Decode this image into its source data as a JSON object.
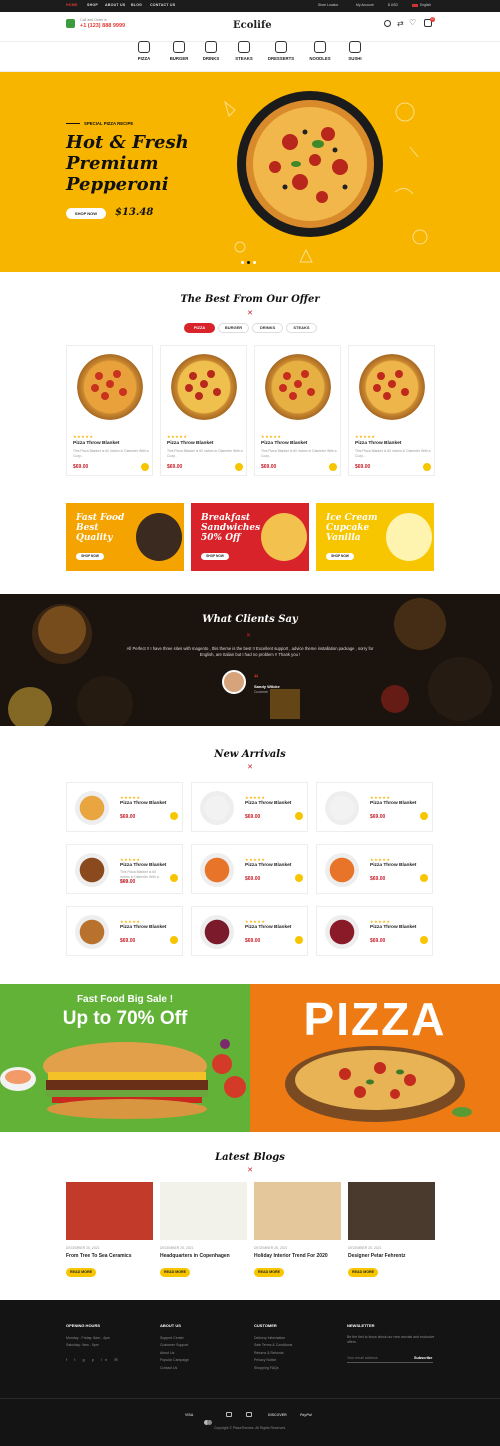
{
  "topnav": {
    "items": [
      "HOME",
      "SHOP",
      "ABOUT US",
      "BLOG",
      "CONTACT US"
    ],
    "store_locator": "Store Locator",
    "my_account": "My Account",
    "currency": "$ USD",
    "language": "English"
  },
  "header": {
    "call_label": "Call and Order in",
    "phone": "+1 (123) 888 9999",
    "logo": "Ecolife",
    "cart_count": "0"
  },
  "categories": [
    {
      "label": "PIZZA",
      "icon": "pizza-icon"
    },
    {
      "label": "BURGER",
      "icon": "burger-icon"
    },
    {
      "label": "DRINKS",
      "icon": "drink-icon"
    },
    {
      "label": "STEAKS",
      "icon": "steak-icon"
    },
    {
      "label": "DRESSERTS",
      "icon": "dessert-icon"
    },
    {
      "label": "NOODLES",
      "icon": "noodles-icon"
    },
    {
      "label": "SUSHI",
      "icon": "sushi-icon"
    }
  ],
  "hero": {
    "kicker": "SPECIAL PIZZA RECIPE",
    "title": "Hot & Fresh Premium Pepperoni",
    "button": "SHOP NOW",
    "price": "$13.48"
  },
  "offer": {
    "title": "The Best From Our Offer",
    "tabs": [
      "PIZZA",
      "BURGER",
      "DRINKS",
      "STEAKS"
    ],
    "products": [
      {
        "name": "Pizza Throw Blanket",
        "desc": "This Pizza Blanket is 60 inches in Diameter With a Cozy...",
        "price": "$69.00",
        "rating": "★★★★★"
      },
      {
        "name": "Pizza Throw Blanket",
        "desc": "This Pizza Blanket is 60 inches in Diameter With a Cozy...",
        "price": "$69.00",
        "rating": "★★★★★"
      },
      {
        "name": "Pizza Throw Blanket",
        "desc": "This Pizza Blanket is 60 inches in Diameter With a Cozy...",
        "price": "$69.00",
        "rating": "★★★★★"
      },
      {
        "name": "Pizza Throw Blanket",
        "desc": "This Pizza Blanket is 60 inches in Diameter With a Cozy...",
        "price": "$69.00",
        "rating": "★★★★★"
      }
    ]
  },
  "banners": [
    {
      "title": "Fast Food Best Quality",
      "button": "SHOP NOW",
      "color": "#f5a300"
    },
    {
      "title": "Breakfast Sandwiches 50% Off",
      "button": "SHOP NOW",
      "color": "#d8232a"
    },
    {
      "title": "Ice Cream Cupcake Vanilla",
      "button": "SHOP NOW",
      "color": "#f7c600"
    }
  ],
  "testimonial": {
    "title": "What Clients Say",
    "quote": "All Perfect !! I have three sites with magento , this theme is the best !! Excellent support , advice theme installation package , sorry for English, are Italian but I had no problem !! Thank you !",
    "name": "Sandy Wilcke",
    "role": "Customer"
  },
  "arrivals": {
    "title": "New Arrivals",
    "items": [
      {
        "name": "Pizza Throw Blanket",
        "price": "$69.00",
        "rating": "★★★★★",
        "desc": ""
      },
      {
        "name": "Pizza Throw Blanket",
        "price": "$69.00",
        "rating": "★★★★★",
        "desc": ""
      },
      {
        "name": "Pizza Throw Blanket",
        "price": "$69.00",
        "rating": "★★★★★",
        "desc": ""
      },
      {
        "name": "Pizza Throw Blanket",
        "price": "$69.00",
        "rating": "★★★★★",
        "desc": "This Pizza Blanket is 60 inches in Diameter With a Cozy..."
      },
      {
        "name": "Pizza Throw Blanket",
        "price": "$69.00",
        "rating": "★★★★★",
        "desc": ""
      },
      {
        "name": "Pizza Throw Blanket",
        "price": "$69.00",
        "rating": "★★★★★",
        "desc": ""
      },
      {
        "name": "Pizza Throw Blanket",
        "price": "$69.00",
        "rating": "★★★★★",
        "desc": ""
      },
      {
        "name": "Pizza Throw Blanket",
        "price": "$69.00",
        "rating": "★★★★★",
        "desc": ""
      },
      {
        "name": "Pizza Throw Blanket",
        "price": "$69.00",
        "rating": "★★★★★",
        "desc": ""
      }
    ]
  },
  "sale": {
    "kicker": "Fast Food Big Sale !",
    "headline": "Up to 70% Off",
    "pizza_word": "PIZZA"
  },
  "blogs": {
    "title": "Latest Blogs",
    "posts": [
      {
        "date": "DECEMBER 25, 2021",
        "title": "From Tree To Sea Ceramics",
        "button": "READ MORE"
      },
      {
        "date": "DECEMBER 25, 2021",
        "title": "Headquarters in Copenhagen",
        "button": "READ MORE"
      },
      {
        "date": "DECEMBER 25, 2021",
        "title": "Holiday Interior Trend For 2020",
        "button": "READ MORE"
      },
      {
        "date": "DECEMBER 25, 2021",
        "title": "Designer Petar Fehrentz",
        "button": "READ MORE"
      }
    ]
  },
  "footer": {
    "hours": {
      "heading": "OPENING HOURS",
      "lines": [
        "Monday - Friday: 8am - 4pm",
        "Saturday: 9am - 5pm"
      ]
    },
    "about": {
      "heading": "ABOUT US",
      "links": [
        "Support Center",
        "Customer Support",
        "About Us",
        "Popular Campaign",
        "Contact Us"
      ]
    },
    "customer": {
      "heading": "CUSTOMER",
      "links": [
        "Delivery Information",
        "Sale Terms & Conditions",
        "Returns & Refunds",
        "Privacy Notice",
        "Shopping FAQs"
      ]
    },
    "newsletter": {
      "heading": "NEWSLETTER",
      "text": "Be the first to know about our new arrivals and exclusive offers.",
      "placeholder": "Your email address",
      "button": "Subscribe"
    },
    "payments": [
      "VISA",
      "DISCOVER",
      "PayPal"
    ],
    "copyright": "Copyright © PlazaThemes. All Rights Reserved."
  }
}
